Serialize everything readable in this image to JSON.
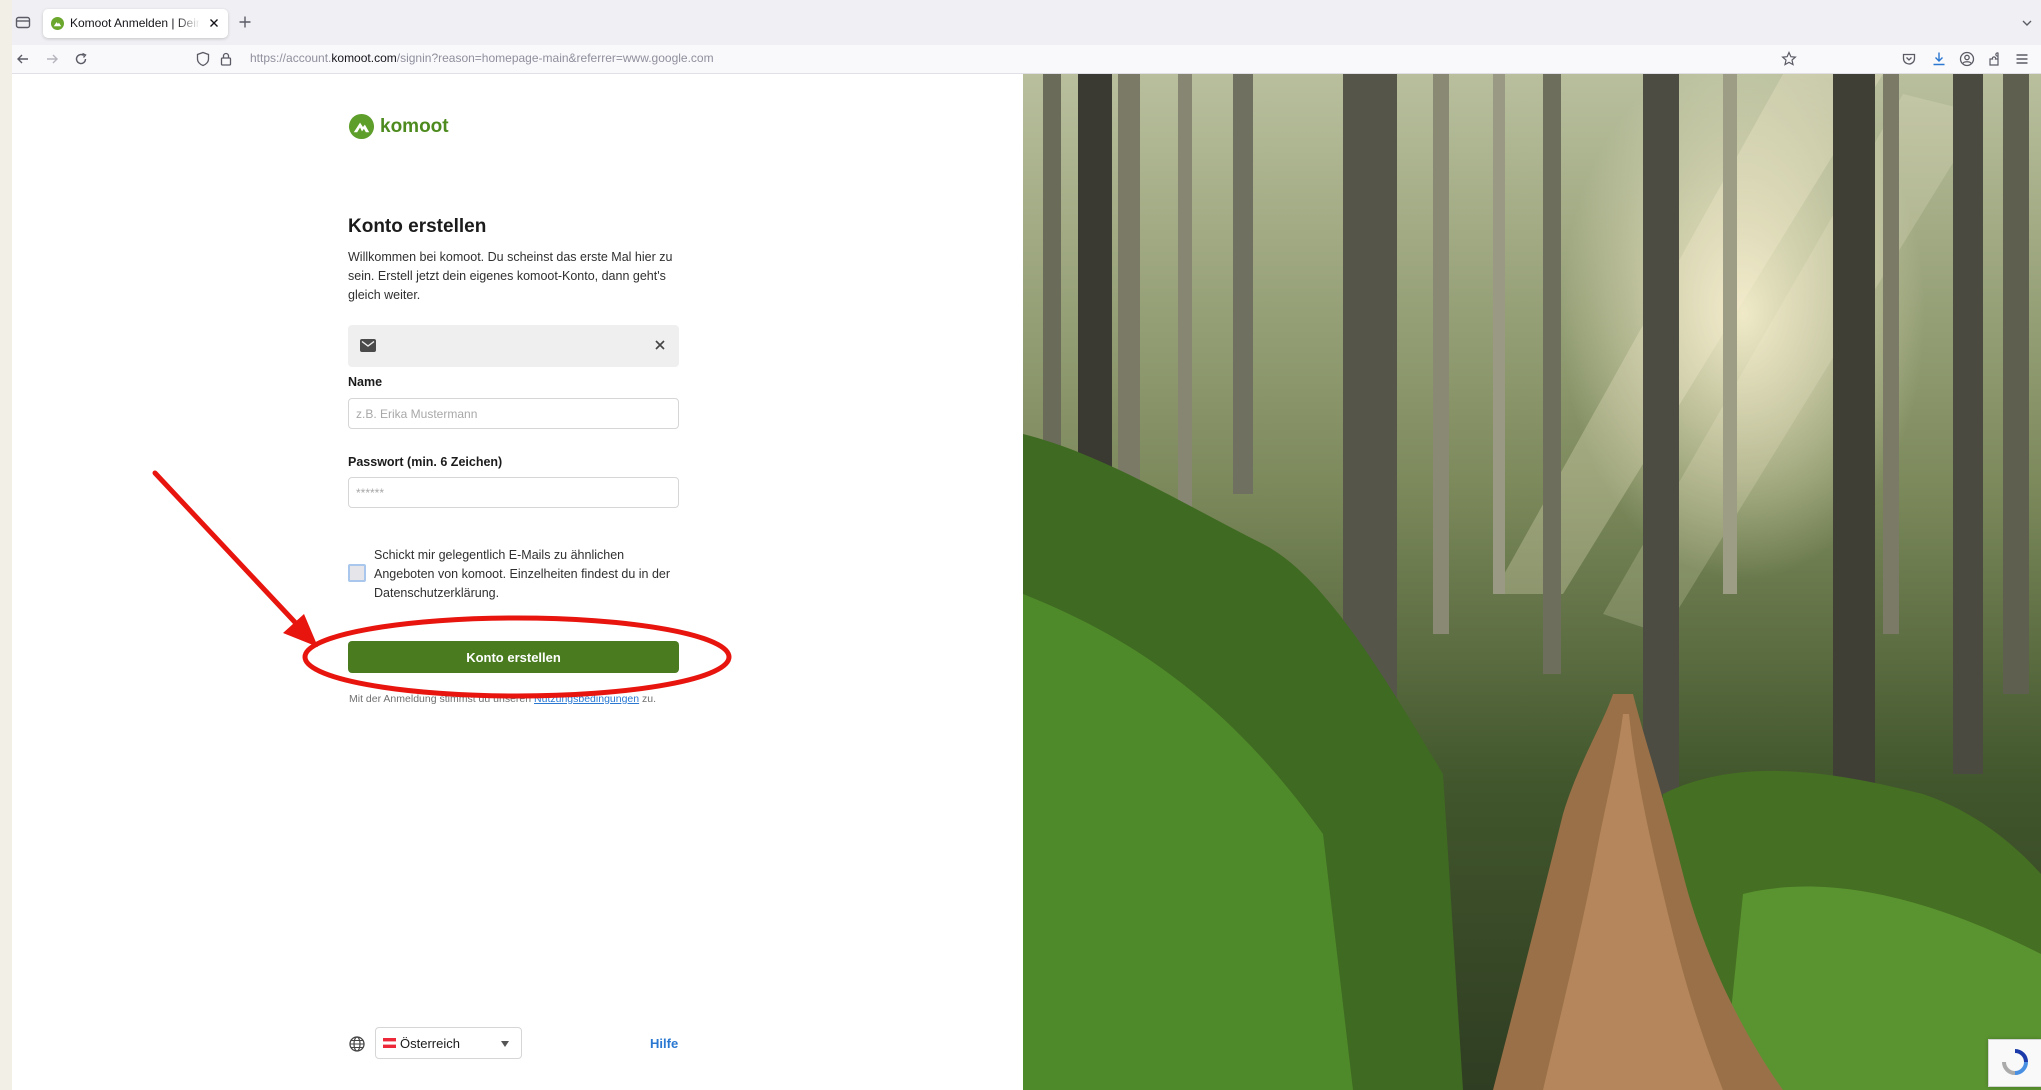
{
  "browser": {
    "tab_title": "Komoot Anmelden | Dein Zugang",
    "url_prefix": "https://account.",
    "url_domain": "komoot.com",
    "url_path": "/signin?reason=homepage-main&referrer=www.google.com"
  },
  "brand": {
    "logo_text": "komoot",
    "accent_color": "#4a7c1f",
    "link_color": "#2a78d2"
  },
  "form": {
    "title": "Konto erstellen",
    "intro": "Willkommen bei komoot. Du scheinst das erste Mal hier zu sein. Erstell jetzt dein eigenes komoot-Konto, dann geht's gleich weiter.",
    "email_value": "",
    "name_label": "Name",
    "name_placeholder": "z.B. Erika Mustermann",
    "password_label": "Passwort (min. 6 Zeichen)",
    "password_placeholder": "******",
    "newsletter_text": "Schickt mir gelegentlich E-Mails zu ähnlichen Angeboten von komoot. Einzelheiten findest du in der Datenschutzerklärung.",
    "submit_label": "Konto erstellen",
    "terms_prefix": "Mit der Anmeldung stimmst du unseren ",
    "terms_link": "Nutzungsbedingungen",
    "terms_suffix": " zu."
  },
  "footer": {
    "country": "Österreich",
    "help_label": "Hilfe"
  },
  "annotation": {
    "color": "#e8150f"
  }
}
